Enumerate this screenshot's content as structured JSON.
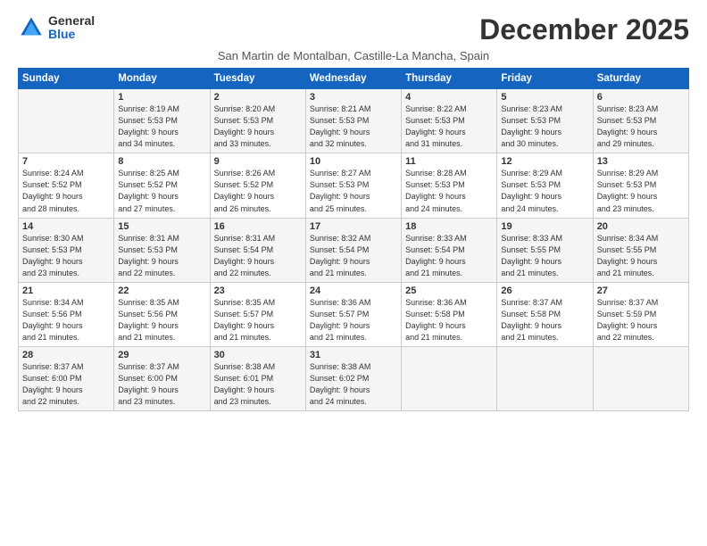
{
  "logo": {
    "general": "General",
    "blue": "Blue"
  },
  "title": "December 2025",
  "subtitle": "San Martin de Montalban, Castille-La Mancha, Spain",
  "days": [
    "Sunday",
    "Monday",
    "Tuesday",
    "Wednesday",
    "Thursday",
    "Friday",
    "Saturday"
  ],
  "weeks": [
    [
      {
        "day": "",
        "info": ""
      },
      {
        "day": "1",
        "info": "Sunrise: 8:19 AM\nSunset: 5:53 PM\nDaylight: 9 hours\nand 34 minutes."
      },
      {
        "day": "2",
        "info": "Sunrise: 8:20 AM\nSunset: 5:53 PM\nDaylight: 9 hours\nand 33 minutes."
      },
      {
        "day": "3",
        "info": "Sunrise: 8:21 AM\nSunset: 5:53 PM\nDaylight: 9 hours\nand 32 minutes."
      },
      {
        "day": "4",
        "info": "Sunrise: 8:22 AM\nSunset: 5:53 PM\nDaylight: 9 hours\nand 31 minutes."
      },
      {
        "day": "5",
        "info": "Sunrise: 8:23 AM\nSunset: 5:53 PM\nDaylight: 9 hours\nand 30 minutes."
      },
      {
        "day": "6",
        "info": "Sunrise: 8:23 AM\nSunset: 5:53 PM\nDaylight: 9 hours\nand 29 minutes."
      }
    ],
    [
      {
        "day": "7",
        "info": "Sunrise: 8:24 AM\nSunset: 5:52 PM\nDaylight: 9 hours\nand 28 minutes."
      },
      {
        "day": "8",
        "info": "Sunrise: 8:25 AM\nSunset: 5:52 PM\nDaylight: 9 hours\nand 27 minutes."
      },
      {
        "day": "9",
        "info": "Sunrise: 8:26 AM\nSunset: 5:52 PM\nDaylight: 9 hours\nand 26 minutes."
      },
      {
        "day": "10",
        "info": "Sunrise: 8:27 AM\nSunset: 5:53 PM\nDaylight: 9 hours\nand 25 minutes."
      },
      {
        "day": "11",
        "info": "Sunrise: 8:28 AM\nSunset: 5:53 PM\nDaylight: 9 hours\nand 24 minutes."
      },
      {
        "day": "12",
        "info": "Sunrise: 8:29 AM\nSunset: 5:53 PM\nDaylight: 9 hours\nand 24 minutes."
      },
      {
        "day": "13",
        "info": "Sunrise: 8:29 AM\nSunset: 5:53 PM\nDaylight: 9 hours\nand 23 minutes."
      }
    ],
    [
      {
        "day": "14",
        "info": "Sunrise: 8:30 AM\nSunset: 5:53 PM\nDaylight: 9 hours\nand 23 minutes."
      },
      {
        "day": "15",
        "info": "Sunrise: 8:31 AM\nSunset: 5:53 PM\nDaylight: 9 hours\nand 22 minutes."
      },
      {
        "day": "16",
        "info": "Sunrise: 8:31 AM\nSunset: 5:54 PM\nDaylight: 9 hours\nand 22 minutes."
      },
      {
        "day": "17",
        "info": "Sunrise: 8:32 AM\nSunset: 5:54 PM\nDaylight: 9 hours\nand 21 minutes."
      },
      {
        "day": "18",
        "info": "Sunrise: 8:33 AM\nSunset: 5:54 PM\nDaylight: 9 hours\nand 21 minutes."
      },
      {
        "day": "19",
        "info": "Sunrise: 8:33 AM\nSunset: 5:55 PM\nDaylight: 9 hours\nand 21 minutes."
      },
      {
        "day": "20",
        "info": "Sunrise: 8:34 AM\nSunset: 5:55 PM\nDaylight: 9 hours\nand 21 minutes."
      }
    ],
    [
      {
        "day": "21",
        "info": "Sunrise: 8:34 AM\nSunset: 5:56 PM\nDaylight: 9 hours\nand 21 minutes."
      },
      {
        "day": "22",
        "info": "Sunrise: 8:35 AM\nSunset: 5:56 PM\nDaylight: 9 hours\nand 21 minutes."
      },
      {
        "day": "23",
        "info": "Sunrise: 8:35 AM\nSunset: 5:57 PM\nDaylight: 9 hours\nand 21 minutes."
      },
      {
        "day": "24",
        "info": "Sunrise: 8:36 AM\nSunset: 5:57 PM\nDaylight: 9 hours\nand 21 minutes."
      },
      {
        "day": "25",
        "info": "Sunrise: 8:36 AM\nSunset: 5:58 PM\nDaylight: 9 hours\nand 21 minutes."
      },
      {
        "day": "26",
        "info": "Sunrise: 8:37 AM\nSunset: 5:58 PM\nDaylight: 9 hours\nand 21 minutes."
      },
      {
        "day": "27",
        "info": "Sunrise: 8:37 AM\nSunset: 5:59 PM\nDaylight: 9 hours\nand 22 minutes."
      }
    ],
    [
      {
        "day": "28",
        "info": "Sunrise: 8:37 AM\nSunset: 6:00 PM\nDaylight: 9 hours\nand 22 minutes."
      },
      {
        "day": "29",
        "info": "Sunrise: 8:37 AM\nSunset: 6:00 PM\nDaylight: 9 hours\nand 23 minutes."
      },
      {
        "day": "30",
        "info": "Sunrise: 8:38 AM\nSunset: 6:01 PM\nDaylight: 9 hours\nand 23 minutes."
      },
      {
        "day": "31",
        "info": "Sunrise: 8:38 AM\nSunset: 6:02 PM\nDaylight: 9 hours\nand 24 minutes."
      },
      {
        "day": "",
        "info": ""
      },
      {
        "day": "",
        "info": ""
      },
      {
        "day": "",
        "info": ""
      }
    ]
  ]
}
